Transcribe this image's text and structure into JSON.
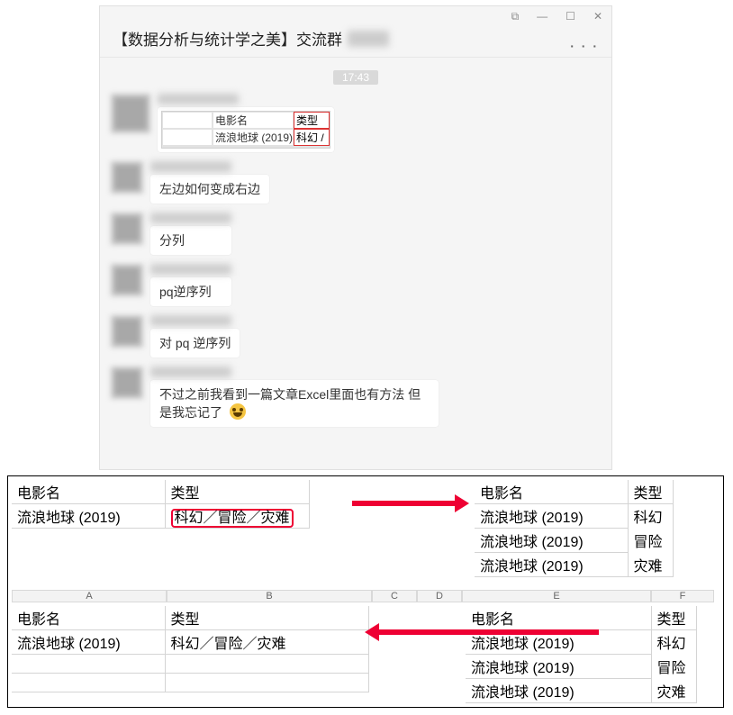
{
  "window": {
    "min": "—",
    "max": "☐",
    "pin": "⧉",
    "close": "✕",
    "title": "【数据分析与统计学之美】交流群",
    "more": "· · ·"
  },
  "timestamp": "17:43",
  "mini_excel": {
    "h1": "电影名",
    "h2": "类型",
    "r1c1": "流浪地球 (2019)",
    "r1c2": "科幻 /"
  },
  "messages": {
    "m1": "左边如何变成右边",
    "m2": "分列",
    "m3": "pq逆序列",
    "m4": "对 pq 逆序列",
    "m5": "不过之前我看到一篇文章Excel里面也有方法 但是我忘记了"
  },
  "diagram": {
    "left_top": {
      "h_name": "电影名",
      "h_type": "类型",
      "r1_name": "流浪地球 (2019)",
      "r1_type": "科幻／冒险／灾难"
    },
    "right_top": {
      "h_name": "电影名",
      "h_type": "类型",
      "rows": [
        {
          "name": "流浪地球 (2019)",
          "type": "科幻"
        },
        {
          "name": "流浪地球 (2019)",
          "type": "冒险"
        },
        {
          "name": "流浪地球 (2019)",
          "type": "灾难"
        }
      ]
    },
    "col_labels": [
      "A",
      "B",
      "C",
      "D",
      "E",
      "F"
    ],
    "left_bot": {
      "h_name": "电影名",
      "h_type": "类型",
      "r1_name": "流浪地球 (2019)",
      "r1_type": "科幻／冒险／灾难"
    },
    "right_bot": {
      "h_name": "电影名",
      "h_type": "类型",
      "rows": [
        {
          "name": "流浪地球 (2019)",
          "type": "科幻"
        },
        {
          "name": "流浪地球 (2019)",
          "type": "冒险"
        },
        {
          "name": "流浪地球 (2019)",
          "type": "灾难"
        }
      ]
    }
  }
}
